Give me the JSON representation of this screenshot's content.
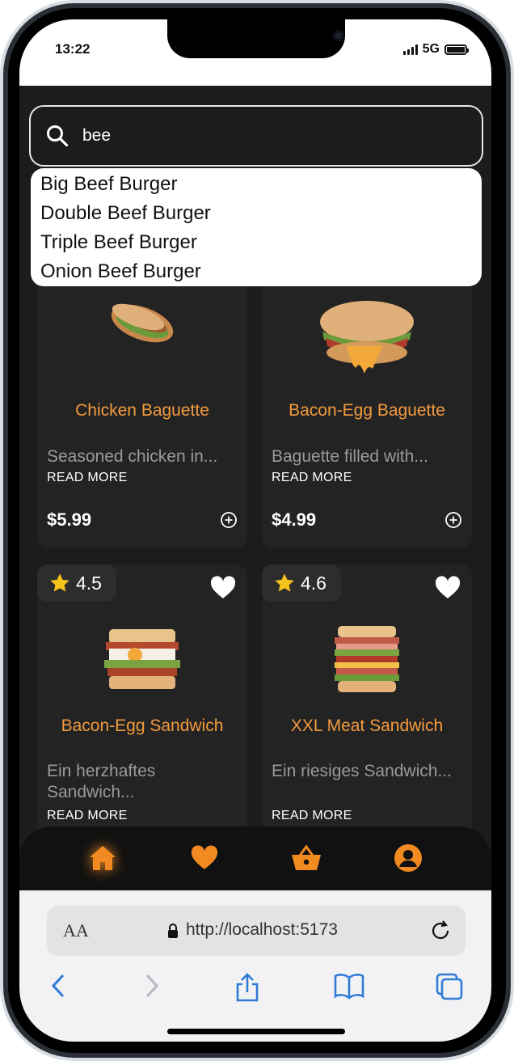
{
  "status": {
    "time": "13:22",
    "network": "5G"
  },
  "search": {
    "value": "bee"
  },
  "suggestions": [
    "Big Beef Burger",
    "Double Beef Burger",
    "Triple Beef Burger",
    "Onion Beef Burger"
  ],
  "products": [
    {
      "name": "Chicken Baguette",
      "desc": "Seasoned chicken in...",
      "more": "READ MORE",
      "price": "$5.99"
    },
    {
      "name": "Bacon-Egg Baguette",
      "desc": "Baguette filled with...",
      "more": "READ MORE",
      "price": "$4.99"
    },
    {
      "name": "Bacon-Egg Sandwich",
      "desc": "Ein herzhaftes Sandwich...",
      "more": "READ MORE",
      "rating": "4.5"
    },
    {
      "name": "XXL Meat Sandwich",
      "desc": "Ein riesiges Sandwich...",
      "more": "READ MORE",
      "rating": "4.6"
    }
  ],
  "nav": [
    "home-icon",
    "heart-icon",
    "basket-icon",
    "profile-icon"
  ],
  "browser": {
    "url": "http://localhost:5173",
    "text_size": "AA"
  },
  "colors": {
    "accent": "#f39a3f",
    "background": "#1c1c1c",
    "card": "#232323"
  }
}
